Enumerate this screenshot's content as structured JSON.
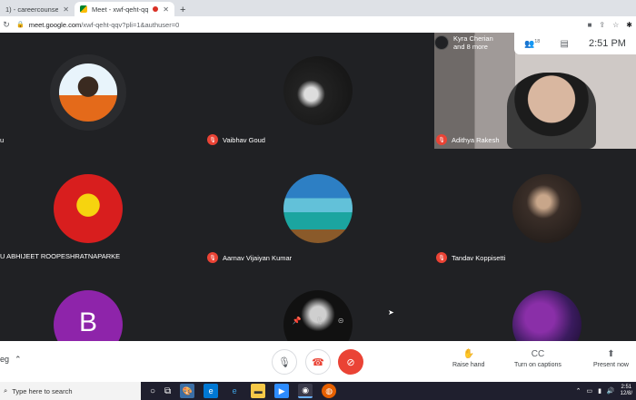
{
  "browser": {
    "tabs": [
      {
        "title": "1) - careercounselor@the...",
        "active": false
      },
      {
        "title": "Meet - xwf-qeht-qqv",
        "active": true,
        "recording": true
      }
    ],
    "new_tab_label": "+",
    "url_host": "meet.google.com",
    "url_path": "/xwf-qeht-qqv?pli=1&authuser=0"
  },
  "meeting": {
    "header": {
      "presenter_name": "Kyra Cherian",
      "presenter_more": "and 8 more",
      "people_count": "18",
      "time": "2:51 PM"
    },
    "participants": [
      {
        "name": "u",
        "muted": false
      },
      {
        "name": "Vaibhav Goud",
        "muted": true
      },
      {
        "name": "Adithya Rakesh",
        "muted": true
      },
      {
        "name": "U ABHIJEET ROOPESHRATNAPARKE",
        "muted": false
      },
      {
        "name": "Aarnav Vijaiyan Kumar",
        "muted": true
      },
      {
        "name": "Tandav Koppisetti",
        "muted": true
      },
      {
        "name": "B",
        "muted": false
      }
    ],
    "avatar_letter": "B"
  },
  "controls": {
    "details_label": "eg",
    "raise_hand_label": "Raise hand",
    "captions_label": "Turn on captions",
    "present_label": "Present now"
  },
  "taskbar": {
    "search_placeholder": "Type here to search",
    "clock_time": "2:51",
    "clock_date": "12/8/"
  },
  "colors": {
    "meet_bg": "#202124",
    "tile_bg": "#3c4043",
    "danger": "#ea4335",
    "taskbar": "#1f1f2e"
  }
}
